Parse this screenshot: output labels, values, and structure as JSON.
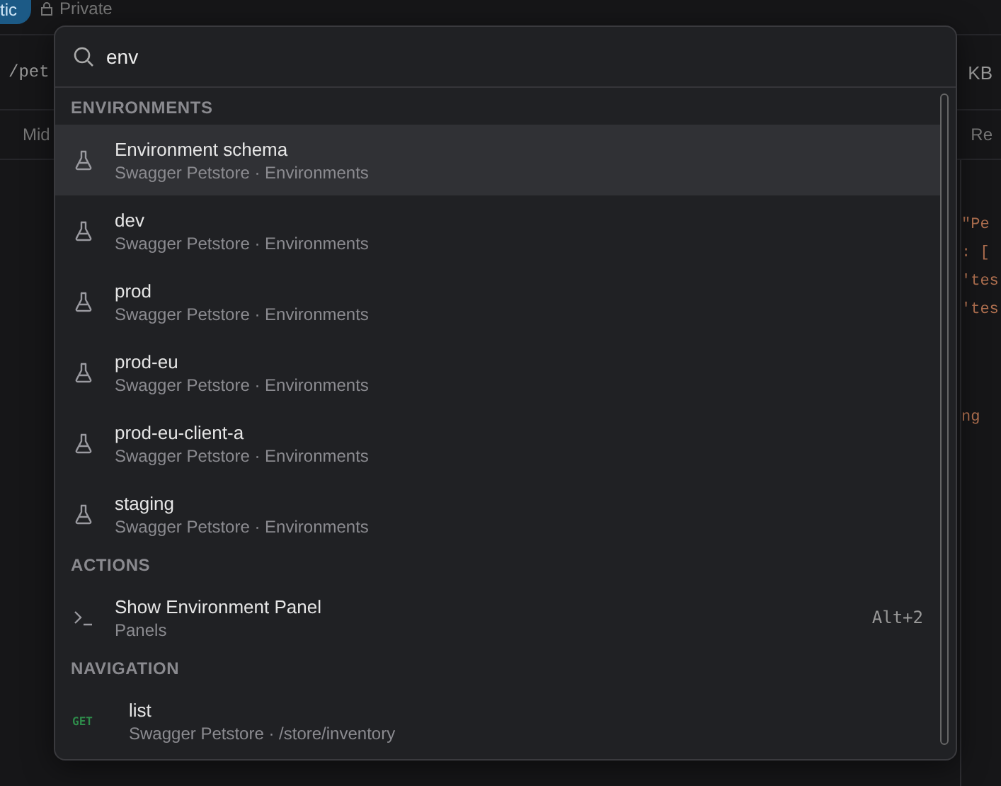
{
  "background": {
    "visibility_badge": "tic",
    "private_label": "Private",
    "url_fragment": "/pet",
    "size_fragment": "KB",
    "tab_left_fragment": "Mid",
    "tab_right_fragment": "Re",
    "code_lines": [
      "\"Pe",
      ": [",
      "'tes",
      "'tes",
      "ng"
    ]
  },
  "palette": {
    "search": {
      "value": "env"
    },
    "sections": [
      {
        "title": "ENVIRONMENTS",
        "items": [
          {
            "kind": "environment",
            "title": "Environment schema",
            "subtitle": "Swagger Petstore · Environments",
            "selected": true
          },
          {
            "kind": "environment",
            "title": "dev",
            "subtitle": "Swagger Petstore · Environments",
            "selected": false
          },
          {
            "kind": "environment",
            "title": "prod",
            "subtitle": "Swagger Petstore · Environments",
            "selected": false
          },
          {
            "kind": "environment",
            "title": "prod-eu",
            "subtitle": "Swagger Petstore · Environments",
            "selected": false
          },
          {
            "kind": "environment",
            "title": "prod-eu-client-a",
            "subtitle": "Swagger Petstore · Environments",
            "selected": false
          },
          {
            "kind": "environment",
            "title": "staging",
            "subtitle": "Swagger Petstore · Environments",
            "selected": false
          }
        ]
      },
      {
        "title": "ACTIONS",
        "items": [
          {
            "kind": "action",
            "title": "Show Environment Panel",
            "subtitle": "Panels",
            "shortcut": "Alt+2",
            "selected": false
          }
        ]
      },
      {
        "title": "NAVIGATION",
        "items": [
          {
            "kind": "request",
            "method": "GET",
            "title": "list",
            "subtitle": "Swagger Petstore · /store/inventory",
            "selected": false
          }
        ]
      }
    ]
  }
}
